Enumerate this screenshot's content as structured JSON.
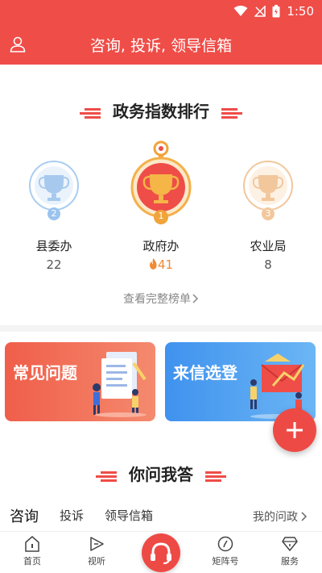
{
  "status": {
    "time": "1:50"
  },
  "header": {
    "title": "咨询, 投诉, 领导信箱"
  },
  "ranking": {
    "title": "政务指数排行",
    "items": [
      {
        "rank": "2",
        "name": "县委办",
        "score": "22"
      },
      {
        "rank": "1",
        "name": "政府办",
        "score": "41"
      },
      {
        "rank": "3",
        "name": "农业局",
        "score": "8"
      }
    ],
    "view_all": "查看完整榜单"
  },
  "cards": [
    {
      "label": "常见问题",
      "color": "#f06e4f"
    },
    {
      "label": "来信选登",
      "color": "#4a9ff0"
    }
  ],
  "qa": {
    "title": "你问我答",
    "tabs": [
      "咨询",
      "投诉",
      "领导信箱"
    ],
    "my_questions": "我的问政"
  },
  "nav": {
    "items": [
      {
        "label": "首页",
        "icon": "home-icon"
      },
      {
        "label": "视听",
        "icon": "play-icon"
      },
      {
        "label": "",
        "icon": "headset-icon"
      },
      {
        "label": "矩阵号",
        "icon": "compass-icon"
      },
      {
        "label": "服务",
        "icon": "diamond-icon"
      }
    ]
  },
  "colors": {
    "brand": "#ef4d48",
    "gold": "#f0a43a",
    "silver": "#9ac4ef",
    "bronze": "#f2c79c"
  }
}
